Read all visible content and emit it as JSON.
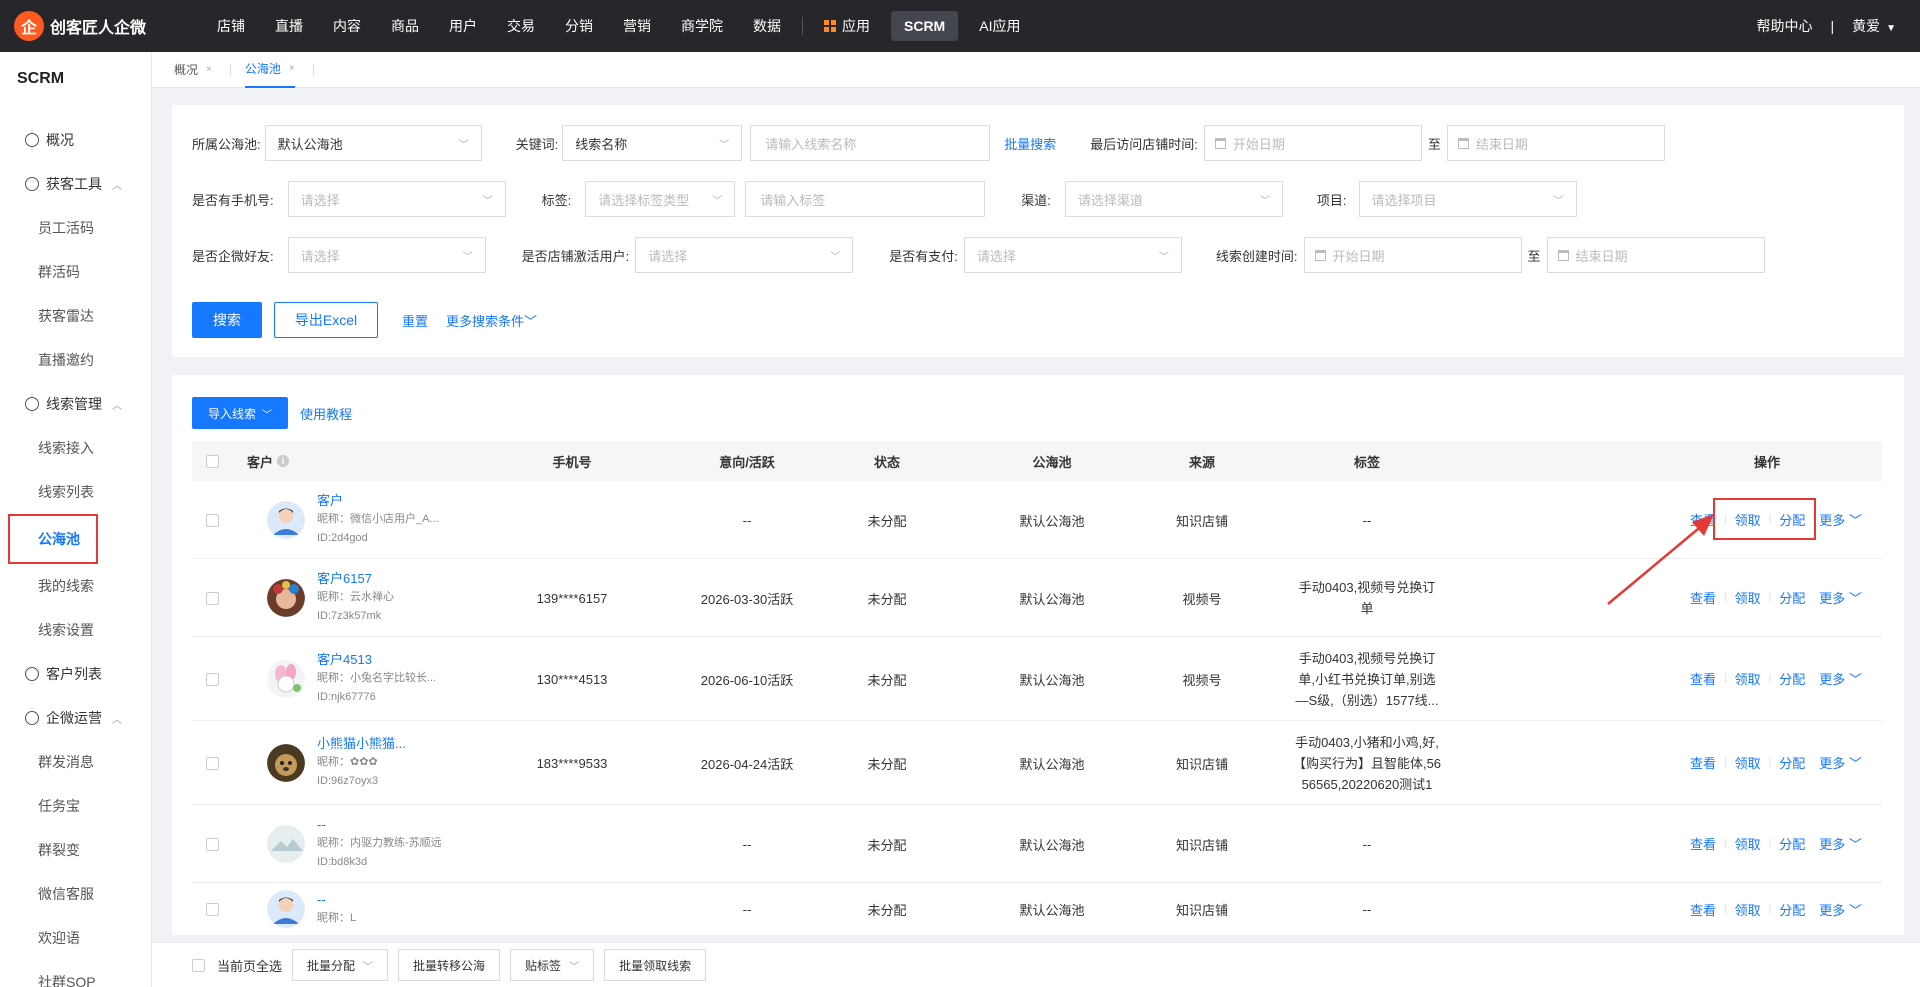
{
  "brand": {
    "name": "创客匠人企微",
    "mark": "企"
  },
  "topnav": {
    "items": [
      "店铺",
      "直播",
      "内容",
      "商品",
      "用户",
      "交易",
      "分销",
      "营销",
      "商学院",
      "数据"
    ],
    "apps_label": "应用",
    "scrm_label": "SCRM",
    "ai_label": "AI应用",
    "help": "帮助中心",
    "divider": "|",
    "user": "黄爱"
  },
  "sidebar": {
    "title": "SCRM",
    "overview": "概况",
    "groups": [
      {
        "label": "获客工具",
        "items": [
          "员工活码",
          "群活码",
          "获客雷达",
          "直播邀约"
        ]
      },
      {
        "label": "线索管理",
        "items": [
          "线索接入",
          "线索列表",
          "公海池",
          "我的线索",
          "线索设置"
        ]
      },
      {
        "label": "客户列表",
        "items": []
      },
      {
        "label": "企微运营",
        "items": [
          "群发消息",
          "任务宝",
          "群裂变",
          "微信客服",
          "欢迎语",
          "社群SOP"
        ]
      }
    ]
  },
  "tabs": [
    {
      "label": "概况",
      "close": "×"
    },
    {
      "label": "公海池",
      "close": "×"
    }
  ],
  "filters": {
    "pool_label": "所属公海池:",
    "pool_value": "默认公海池",
    "keyword_label": "关键词:",
    "keyword_type": "线索名称",
    "keyword_placeholder": "请输入线索名称",
    "batch_search": "批量搜索",
    "last_visit_label": "最后访问店铺时间:",
    "start_date": "开始日期",
    "to": "至",
    "end_date": "结束日期",
    "phone_label": "是否有手机号:",
    "please_select": "请选择",
    "tag_label": "标签:",
    "tag_type_placeholder": "请选择标签类型",
    "tag_placeholder": "请输入标签",
    "channel_label": "渠道:",
    "channel_placeholder": "请选择渠道",
    "project_label": "项目:",
    "project_placeholder": "请选择项目",
    "wechat_friend_label": "是否企微好友:",
    "activated_label": "是否店铺激活用户:",
    "paid_label": "是否有支付:",
    "created_label": "线索创建时间:",
    "search_btn": "搜索",
    "export_btn": "导出Excel",
    "reset": "重置",
    "more_conditions": "更多搜索条件"
  },
  "table": {
    "import_btn": "导入线索",
    "tutorial": "使用教程",
    "headers": [
      "客户",
      "手机号",
      "意向/活跃",
      "状态",
      "公海池",
      "来源",
      "标签",
      "操作"
    ],
    "ops": {
      "view": "查看",
      "claim": "领取",
      "assign": "分配",
      "more": "更多"
    },
    "rows": [
      {
        "name": "客户",
        "nickname": "昵称：微信小店用户_A...",
        "id": "ID:2d4god",
        "phone": "",
        "intent": "--",
        "status": "未分配",
        "pool": "默认公海池",
        "source": "知识店铺",
        "tags": [
          "--"
        ]
      },
      {
        "name": "客户6157",
        "nickname": "昵称：云水禅心",
        "id": "ID:7z3k57mk",
        "phone": "139****6157",
        "intent": "2026-03-30活跃",
        "status": "未分配",
        "pool": "默认公海池",
        "source": "视频号",
        "tags": [
          "手动0403,视频号兑换订",
          "单"
        ]
      },
      {
        "name": "客户4513",
        "nickname": "昵称：小兔名字比较长...",
        "id": "ID:njk67776",
        "phone": "130****4513",
        "intent": "2026-06-10活跃",
        "status": "未分配",
        "pool": "默认公海池",
        "source": "视频号",
        "tags": [
          "手动0403,视频号兑换订",
          "单,小红书兑换订单,别选",
          "—S级,（别选）1577线..."
        ]
      },
      {
        "name": "小熊猫小熊猫...",
        "nickname": "昵称：✿✿✿",
        "id": "ID:96z7oyx3",
        "phone": "183****9533",
        "intent": "2026-04-24活跃",
        "status": "未分配",
        "pool": "默认公海池",
        "source": "知识店铺",
        "tags": [
          "手动0403,小猪和小鸡,好,",
          "【购买行为】且智能体,56",
          "56565,20220620测试1"
        ]
      },
      {
        "name": "--",
        "nickname": "昵称：内驱力教练-苏顺远",
        "id": "ID:bd8k3d",
        "phone": "",
        "intent": "--",
        "status": "未分配",
        "pool": "默认公海池",
        "source": "知识店铺",
        "tags": [
          "--"
        ]
      },
      {
        "name": "--",
        "nickname": "昵称：L",
        "id": "",
        "phone": "",
        "intent": "--",
        "status": "未分配",
        "pool": "默认公海池",
        "source": "知识店铺",
        "tags": [
          "--"
        ]
      }
    ]
  },
  "footer": {
    "select_all": "当前页全选",
    "batch_assign": "批量分配",
    "batch_transfer": "批量转移公海",
    "tag": "贴标签",
    "batch_claim": "批量领取线索"
  },
  "colors": {
    "primary": "#1677ff",
    "nav_bg": "#26262b",
    "highlight": "#e53935",
    "brand": "#ff5a1f"
  }
}
